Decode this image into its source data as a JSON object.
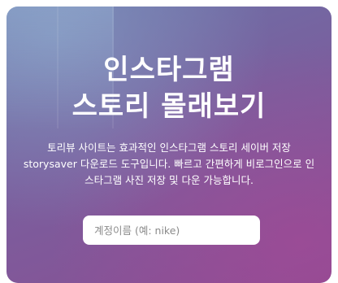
{
  "hero": {
    "title_line1": "인스타그램",
    "title_line2": "스토리 몰래보기",
    "description": "토리뷰 사이트는 효과적인 인스타그램 스토리 세이버 저장 storysaver 다운로드 도구입니다. 빠르고 간편하게 비로그인으로 인스타그램 사진 저장 및 다운 가능합니다."
  },
  "search": {
    "value": "",
    "placeholder": "계정이름 (예: nike)"
  },
  "colors": {
    "gradient_top": "#6a74a8",
    "gradient_bottom": "#8a4e93",
    "text": "#ffffff",
    "input_background": "#ffffff"
  }
}
